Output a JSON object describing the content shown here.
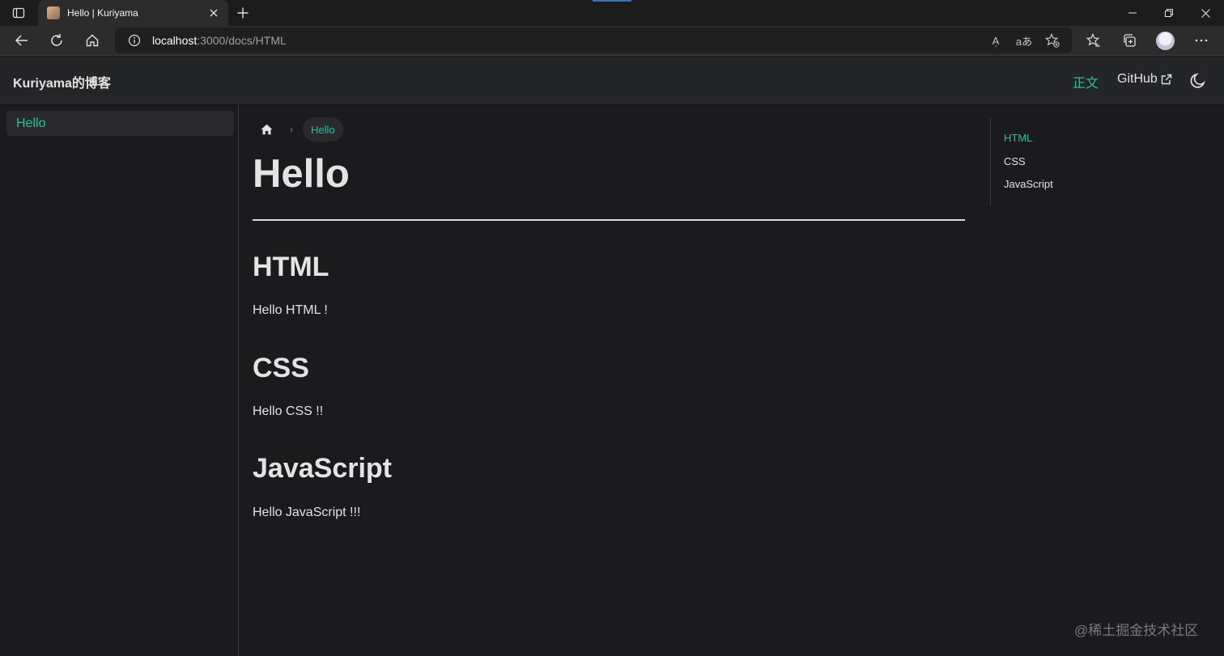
{
  "browser": {
    "tab_title": "Hello | Kuriyama",
    "url_host": "localhost",
    "url_rest": ":3000/docs/HTML",
    "read_aloud_label": "Aͅ",
    "translate_label": "aあ"
  },
  "navbar": {
    "brand": "Kuriyama的博客",
    "doc_link": "正文",
    "github_link": "GitHub"
  },
  "sidebar": {
    "items": [
      {
        "label": "Hello"
      }
    ]
  },
  "breadcrumb": {
    "separator": "›",
    "current": "Hello"
  },
  "doc": {
    "title": "Hello",
    "sections": [
      {
        "heading": "HTML",
        "text": "Hello HTML !"
      },
      {
        "heading": "CSS",
        "text": "Hello CSS !!"
      },
      {
        "heading": "JavaScript",
        "text": "Hello JavaScript !!!"
      }
    ]
  },
  "toc": {
    "items": [
      {
        "label": "HTML",
        "active": true
      },
      {
        "label": "CSS",
        "active": false
      },
      {
        "label": "JavaScript",
        "active": false
      }
    ]
  },
  "watermark": "@稀土掘金技术社区",
  "colors": {
    "accent": "#25c2a0",
    "background": "#1b1b1d",
    "navbar": "#242526",
    "text": "#e3e3e3"
  },
  "icons": [
    "sidebar-toggle-icon",
    "close-icon",
    "plus-icon",
    "minimize-icon",
    "restore-icon",
    "back-arrow-icon",
    "refresh-icon",
    "home-icon",
    "info-icon",
    "favorite-add-icon",
    "favorites-icon",
    "collections-icon",
    "more-icon",
    "external-link-icon",
    "moon-icon"
  ]
}
